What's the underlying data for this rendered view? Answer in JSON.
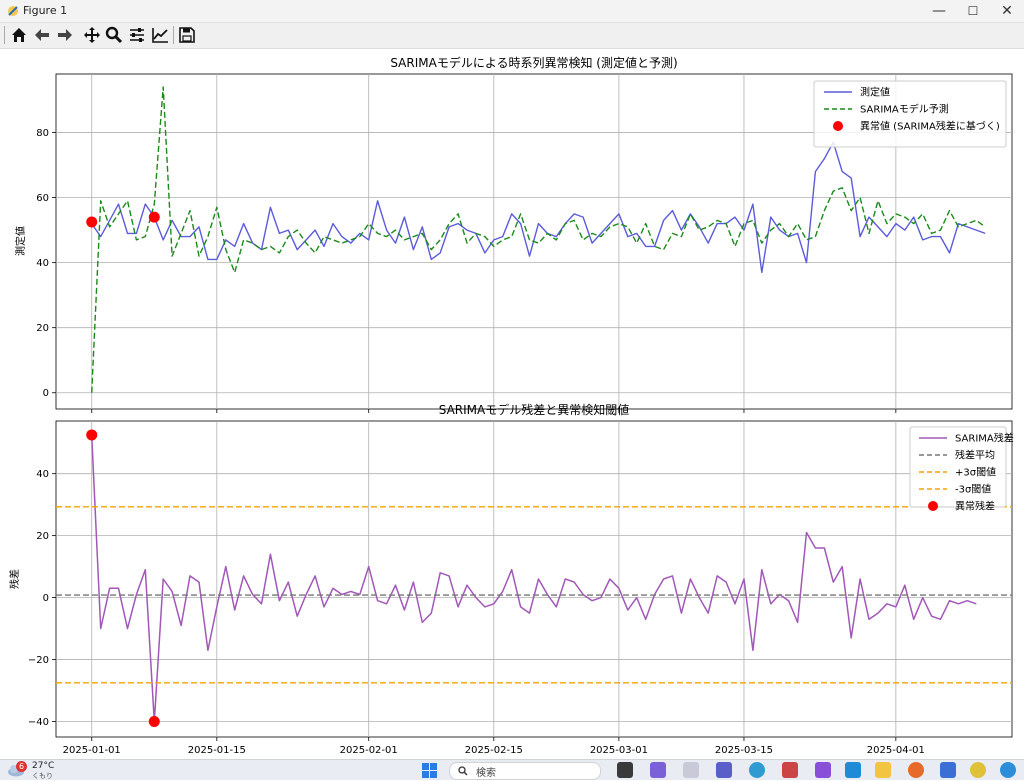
{
  "window": {
    "title": "Figure 1",
    "min_glyph": "—",
    "max_glyph": "☐",
    "close_glyph": "✕"
  },
  "toolbar": {
    "buttons": [
      {
        "name": "home",
        "icon": "home-icon"
      },
      {
        "name": "back",
        "icon": "arrow-left-icon"
      },
      {
        "name": "forward",
        "icon": "arrow-right-icon"
      },
      {
        "name": "pan",
        "icon": "move-icon"
      },
      {
        "name": "zoom",
        "icon": "zoom-icon"
      },
      {
        "name": "configure-subplots",
        "icon": "sliders-icon"
      },
      {
        "name": "edit-axis",
        "icon": "line-chart-icon"
      },
      {
        "name": "save",
        "icon": "save-icon"
      }
    ]
  },
  "colors": {
    "measured": "#5b5bdc",
    "prediction": "#1a8a1a",
    "anomaly": "#ff0000",
    "residual": "#a158b8",
    "mean": "#777777",
    "threshold": "#f5a300"
  },
  "chart_data": [
    {
      "type": "line",
      "title": "SARIMAモデルによる時系列異常検知 (測定値と予測)",
      "xlabel": "",
      "ylabel": "測定値",
      "x_start": "2025-01-01",
      "x_step_days": 1,
      "xlim": [
        "2024-12-28",
        "2025-04-14"
      ],
      "ylim": [
        -5,
        98
      ],
      "yticks": [
        0,
        20,
        40,
        60,
        80
      ],
      "grid": true,
      "legend_position": "top-right",
      "series": [
        {
          "name": "測定値",
          "style": "solid",
          "values": [
            52,
            48,
            53,
            58,
            49,
            49,
            58,
            54,
            47,
            53,
            48,
            48,
            51,
            41,
            41,
            47,
            45,
            52,
            46,
            44,
            57,
            49,
            50,
            44,
            47,
            50,
            45,
            52,
            48,
            46,
            49,
            47,
            59,
            50,
            46,
            54,
            44,
            51,
            41,
            43,
            51,
            52,
            50,
            49,
            43,
            47,
            48,
            55,
            52,
            42,
            52,
            49,
            48,
            52,
            55,
            54,
            46,
            49,
            52,
            55,
            48,
            49,
            45,
            45,
            53,
            56,
            50,
            55,
            51,
            46,
            52,
            52,
            54,
            50,
            58,
            37,
            54,
            50,
            48,
            49,
            40,
            68,
            72,
            77,
            68,
            66,
            48,
            54,
            51,
            48,
            52,
            50,
            54,
            47,
            48,
            48,
            43,
            52,
            51,
            50,
            49
          ]
        },
        {
          "name": "SARIMAモデル予測",
          "style": "dashed",
          "values": [
            0,
            59,
            51,
            55,
            59,
            47,
            48,
            58,
            94,
            42,
            49,
            56,
            42,
            48,
            57,
            44,
            37,
            47,
            46,
            44,
            45,
            43,
            48,
            50,
            46,
            43,
            48,
            47,
            46,
            47,
            48,
            52,
            49,
            48,
            50,
            47,
            48,
            49,
            44,
            47,
            52,
            55,
            46,
            49,
            48,
            45,
            47,
            48,
            55,
            47,
            46,
            49,
            47,
            52,
            53,
            47,
            49,
            48,
            51,
            52,
            51,
            46,
            52,
            45,
            44,
            49,
            48,
            55,
            50,
            51,
            53,
            52,
            45,
            52,
            53,
            46,
            50,
            52,
            48,
            52,
            47,
            48,
            56,
            62,
            63,
            56,
            60,
            49,
            59,
            52,
            55,
            54,
            52,
            55,
            49,
            50,
            56,
            51,
            52,
            53,
            51
          ]
        },
        {
          "name": "異常値 (SARIMA残差に基づく)",
          "style": "marker",
          "x": [
            "2025-01-01",
            "2025-01-08"
          ],
          "values": [
            52.5,
            54
          ]
        }
      ]
    },
    {
      "type": "line",
      "title": "SARIMAモデル残差と異常検知閾値",
      "xlabel": "",
      "ylabel": "残差",
      "x_start": "2025-01-01",
      "x_step_days": 1,
      "xlim": [
        "2024-12-28",
        "2025-04-14"
      ],
      "ylim": [
        -45,
        57
      ],
      "yticks": [
        -40,
        -20,
        0,
        20,
        40
      ],
      "xticks": [
        "2025-01-01",
        "2025-01-15",
        "2025-02-01",
        "2025-02-15",
        "2025-03-01",
        "2025-03-15",
        "2025-04-01"
      ],
      "grid": true,
      "legend_position": "top-right",
      "series": [
        {
          "name": "SARIMA残差",
          "style": "solid",
          "values": [
            52.5,
            -10,
            3,
            3,
            -10,
            1,
            9,
            -40,
            6,
            2,
            -9,
            7,
            5,
            -17,
            -3,
            10,
            -4,
            7,
            1,
            -2,
            14,
            -1,
            5,
            -6,
            1,
            7,
            -3,
            3,
            1,
            2,
            1,
            10,
            -1,
            -2,
            4,
            -4,
            5,
            -8,
            -5,
            8,
            7,
            -3,
            4,
            0,
            -3,
            -2,
            2,
            9,
            -3,
            -5,
            6,
            1,
            -3,
            6,
            5,
            1,
            -1,
            0,
            6,
            3,
            -4,
            0,
            -7,
            1,
            6,
            7,
            -5,
            6,
            0,
            -5,
            7,
            5,
            -2,
            6,
            -17,
            9,
            -2,
            1,
            -1,
            -8,
            21,
            16,
            16,
            5,
            10,
            -13,
            6,
            -7,
            -5,
            -2,
            -3,
            4,
            -7,
            0,
            -6,
            -7,
            -1,
            -2,
            -1,
            -2
          ]
        },
        {
          "name": "残差平均",
          "style": "dashed",
          "constant": 0.8
        },
        {
          "name": "+3σ閾値",
          "style": "dashed",
          "constant": 29.3
        },
        {
          "name": "-3σ閾値",
          "style": "dashed",
          "constant": -27.5
        },
        {
          "name": "異常残差",
          "style": "marker",
          "x": [
            "2025-01-01",
            "2025-01-08"
          ],
          "values": [
            52.5,
            -40
          ]
        }
      ]
    }
  ],
  "taskbar": {
    "weather_temp": "27°C",
    "weather_sub": "くもり",
    "notification_count": "6",
    "search_placeholder": "検索"
  }
}
